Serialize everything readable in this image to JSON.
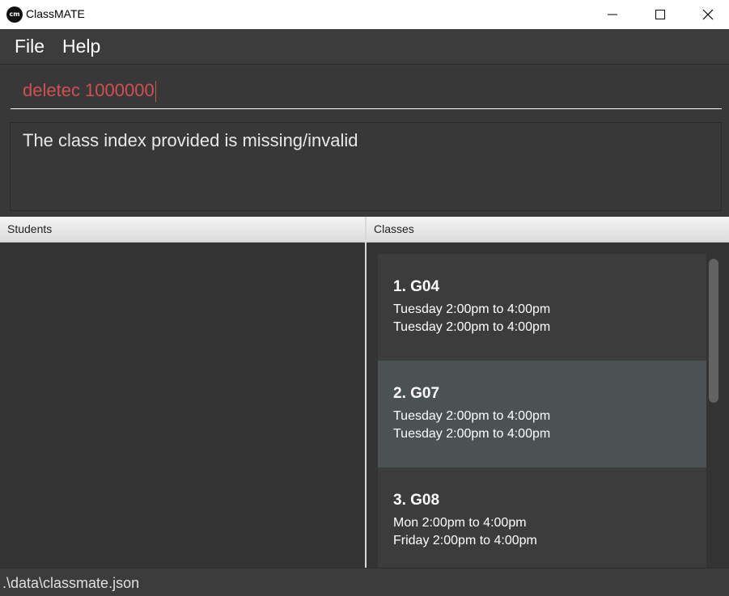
{
  "window": {
    "title": "ClassMATE",
    "icon_label": "cm"
  },
  "menu": {
    "file_label": "File",
    "help_label": "Help"
  },
  "command": {
    "value": "deletec 1000000"
  },
  "result": {
    "message": "The class index provided is missing/invalid"
  },
  "panels": {
    "students_header": "Students",
    "classes_header": "Classes"
  },
  "classes": [
    {
      "index_title": "1.  G04",
      "time1": "Tuesday 2:00pm to 4:00pm",
      "time2": "Tuesday 2:00pm to 4:00pm"
    },
    {
      "index_title": "2.  G07",
      "time1": "Tuesday 2:00pm to 4:00pm",
      "time2": "Tuesday 2:00pm to 4:00pm"
    },
    {
      "index_title": "3.  G08",
      "time1": "Mon 2:00pm to 4:00pm",
      "time2": "Friday 2:00pm to 4:00pm"
    }
  ],
  "status": {
    "file_path": ".\\data\\classmate.json"
  },
  "colors": {
    "command_text": "#d05050",
    "selected_card": "#4a5254",
    "background": "#3c3c3c"
  }
}
